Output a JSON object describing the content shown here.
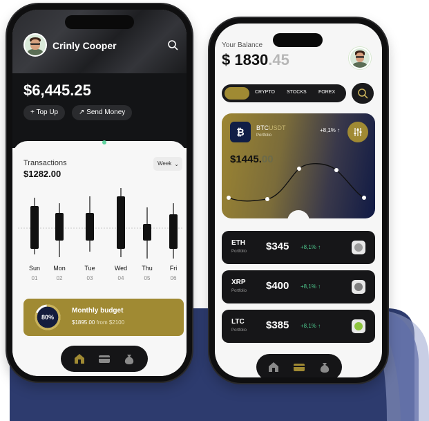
{
  "colors": {
    "gold": "#a08a33",
    "navy": "#2d3b6e",
    "dark": "#131416",
    "positive": "#4cc38a"
  },
  "phone1": {
    "user_name": "Crinly Cooper",
    "balance": "$6,445.25",
    "actions": {
      "top_up": "+ Top Up",
      "send_money": "↗ Send Money"
    },
    "transactions": {
      "label": "Transactions",
      "amount": "$1282.00",
      "period": "Week"
    },
    "days": [
      {
        "name": "Sun",
        "num": "01"
      },
      {
        "name": "Mon",
        "num": "02"
      },
      {
        "name": "Tue",
        "num": "03"
      },
      {
        "name": "Wed",
        "num": "04"
      },
      {
        "name": "Thu",
        "num": "05"
      },
      {
        "name": "Fri",
        "num": "06"
      }
    ],
    "budget": {
      "percent_label": "80%",
      "percent": 0.8,
      "title": "Monthly budget",
      "amount": "$1895.00",
      "from": "from $2100"
    },
    "tabs": [
      "home-icon",
      "card-icon",
      "moneybag-icon"
    ]
  },
  "phone2": {
    "balance_label": "Your Balance",
    "balance_whole": "$ 1830",
    "balance_cents": ".45",
    "filters": [
      "CRYPTO",
      "STOCKS",
      "FOREX"
    ],
    "btc": {
      "symbol": "₿",
      "pair_base": "BTC",
      "pair_quote": "USDT",
      "sub": "Portfolio",
      "change": "+8,1% ↑",
      "value_main": "$1445.",
      "value_dec": "00"
    },
    "coins": [
      {
        "sym": "ETH",
        "sub": "Portfolio",
        "price": "$345",
        "change": "+8,1% ↑",
        "color": "#9c9c9c"
      },
      {
        "sym": "XRP",
        "sub": "Portfolio",
        "price": "$400",
        "change": "+8,1% ↑",
        "color": "#7f7f7f"
      },
      {
        "sym": "LTC",
        "sub": "Portfolio",
        "price": "$385",
        "change": "+8,1% ↑",
        "color": "#8ec43f"
      }
    ],
    "tabs": [
      "home-icon",
      "card-icon",
      "moneybag-icon"
    ]
  }
}
